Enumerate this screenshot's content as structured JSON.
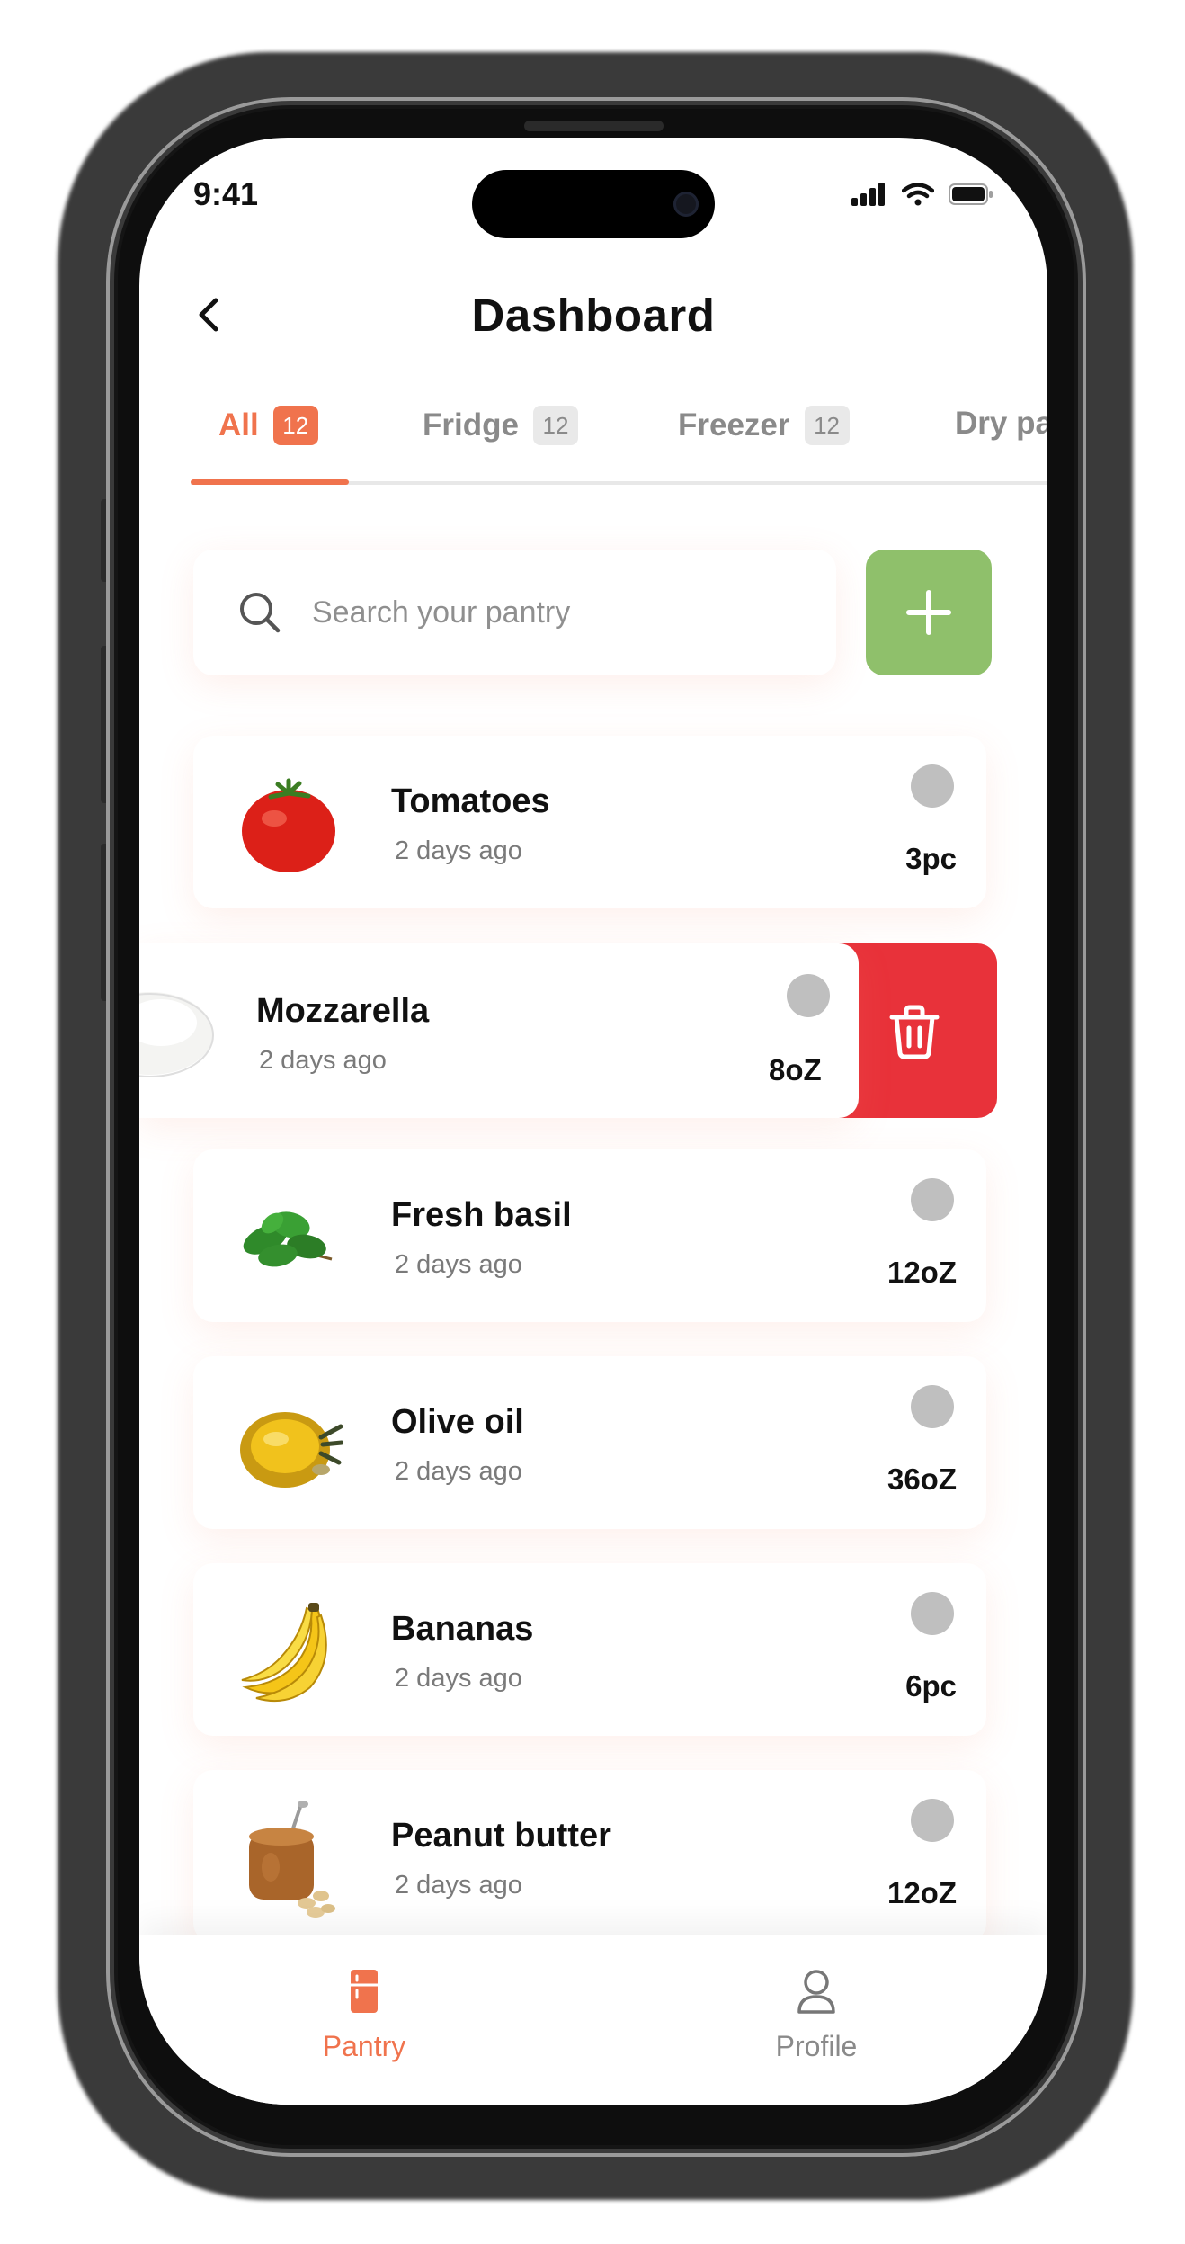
{
  "status_bar": {
    "time": "9:41"
  },
  "header": {
    "title": "Dashboard"
  },
  "tabs": [
    {
      "label": "All",
      "count": "12",
      "active": true
    },
    {
      "label": "Fridge",
      "count": "12",
      "active": false
    },
    {
      "label": "Freezer",
      "count": "12",
      "active": false
    },
    {
      "label": "Dry pa",
      "count": "",
      "active": false
    }
  ],
  "search": {
    "placeholder": "Search your pantry"
  },
  "items": [
    {
      "name": "Tomatoes",
      "added": "2 days ago",
      "quantity": "3pc",
      "icon": "tomato-icon"
    },
    {
      "name": "Mozzarella",
      "added": "2 days ago",
      "quantity": "8oZ",
      "icon": "mozzarella-icon",
      "swiped": true
    },
    {
      "name": "Fresh basil",
      "added": "2 days ago",
      "quantity": "12oZ",
      "icon": "basil-icon"
    },
    {
      "name": "Olive oil",
      "added": "2 days ago",
      "quantity": "36oZ",
      "icon": "olive-oil-icon"
    },
    {
      "name": "Bananas",
      "added": "2 days ago",
      "quantity": "6pc",
      "icon": "banana-icon"
    },
    {
      "name": "Peanut butter",
      "added": "2 days ago",
      "quantity": "12oZ",
      "icon": "peanut-butter-icon"
    }
  ],
  "bottom_nav": [
    {
      "label": "Pantry",
      "icon": "fridge-icon",
      "active": true
    },
    {
      "label": "Profile",
      "icon": "user-icon",
      "active": false
    }
  ],
  "colors": {
    "accent": "#f0734d",
    "add_button": "#8fc06b",
    "delete_button": "#e8323a",
    "status_dot": "#bfbfbf"
  }
}
